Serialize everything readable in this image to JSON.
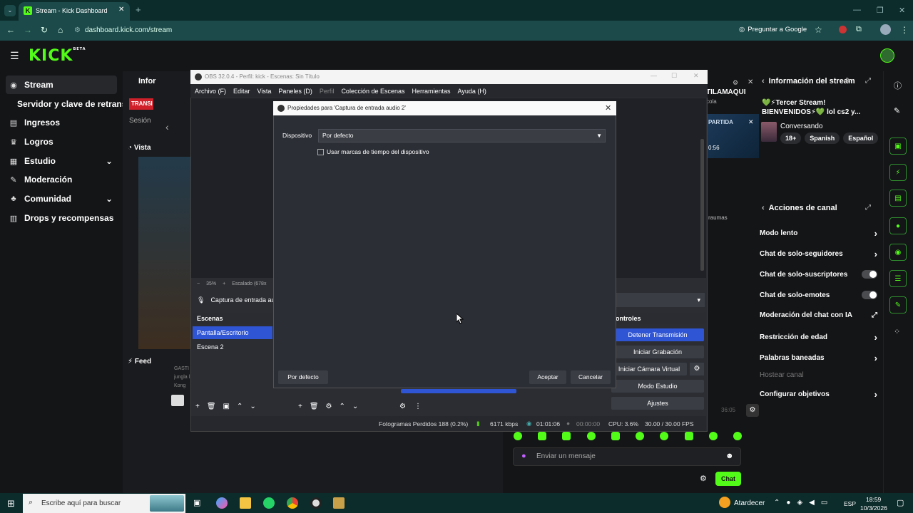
{
  "browser": {
    "tab_title": "Stream - Kick Dashboard",
    "url": "dashboard.kick.com/stream",
    "ask_google": "Preguntar a Google"
  },
  "kick": {
    "logo": "KICK",
    "beta": "BETA",
    "nav": [
      {
        "label": "Stream",
        "icon": "stream-icon"
      },
      {
        "label": "Servidor y clave de retransm",
        "icon": ""
      },
      {
        "label": "Ingresos",
        "icon": "chart-icon"
      },
      {
        "label": "Logros",
        "icon": "trophy-icon"
      },
      {
        "label": "Estudio",
        "icon": "studio-icon"
      },
      {
        "label": "Moderación",
        "icon": "wrench-icon"
      },
      {
        "label": "Comunidad",
        "icon": "community-icon"
      },
      {
        "label": "Drops y recompensas",
        "icon": "drops-icon"
      }
    ],
    "center": {
      "info_label": "Infor",
      "transmit_badge": "TRANSI",
      "session_label": "Sesión",
      "vista_label": "Vista",
      "feed_label": "Feed",
      "feed_text": "GASTI jungla l Kong"
    },
    "chat_bits": {
      "title_fragment": "TILAMAQUI",
      "sub_fragment": "cola",
      "partida": "PARTIDA",
      "time": "0:56",
      "fragment": "raumas",
      "viewer_count": "36:05",
      "input_placeholder": "Enviar un mensaje",
      "chat_button": "Chat"
    },
    "stream_info": {
      "title": "Información del stream",
      "stream_title": "💚⚡Tercer Stream! BIENVENIDOS⚡💚 lol cs2 y...",
      "category": "Conversando",
      "tags": [
        "18+",
        "Spanish",
        "Español"
      ]
    },
    "channel_actions": {
      "title": "Acciones de canal",
      "items": [
        {
          "label": "Modo lento",
          "kind": "arrow"
        },
        {
          "label": "Chat de solo-seguidores",
          "kind": "arrow"
        },
        {
          "label": "Chat de solo-suscriptores",
          "kind": "toggle"
        },
        {
          "label": "Chat de solo-emotes",
          "kind": "toggle"
        },
        {
          "label": "Moderación del chat con IA",
          "kind": "external"
        },
        {
          "label": "Restricción de edad",
          "kind": "arrow"
        },
        {
          "label": "Palabras baneadas",
          "kind": "arrow"
        },
        {
          "label": "Hostear canal",
          "kind": "none"
        },
        {
          "label": "Configurar objetivos",
          "kind": "arrow"
        }
      ]
    }
  },
  "obs": {
    "title": "OBS 32.0.4 - Perfil: kick - Escenas: Sin Título",
    "menu": [
      "Archivo (F)",
      "Editar",
      "Vista",
      "Paneles (D)",
      "Perfil",
      "Colección de Escenas",
      "Herramientas",
      "Ayuda (H)"
    ],
    "zoom": "35%",
    "scaling": "Escalado (678x",
    "source": "Captura de entrada au",
    "scenes_header": "Escenas",
    "scenes": [
      "Pantalla/Escritorio",
      "Escena 2"
    ],
    "controls_header": "ontroles",
    "controls": [
      "Detener Transmisión",
      "Iniciar Grabación",
      "Iniciar Cámara Virtual",
      "Modo Estudio",
      "Ajustes"
    ],
    "status": {
      "dropped": "Fotogramas Perdidos 188 (0.2%)",
      "bitrate": "6171 kbps",
      "live_time": "01:01:06",
      "rec_time": "00:00:00",
      "cpu": "CPU: 3.6%",
      "fps": "30.00 / 30.00 FPS"
    }
  },
  "dialog": {
    "title": "Propiedades para 'Captura de entrada audio 2'",
    "device_label": "Dispositivo",
    "device_value": "Por defecto",
    "timestamp_checkbox": "Usar marcas de tiempo del dispositivo",
    "defaults_button": "Por defecto",
    "ok_button": "Aceptar",
    "cancel_button": "Cancelar"
  },
  "taskbar": {
    "search_placeholder": "Escribe aquí para buscar",
    "weather": "Atardecer",
    "lang": "ESP",
    "time": "18:59",
    "date": "10/3/2026"
  }
}
